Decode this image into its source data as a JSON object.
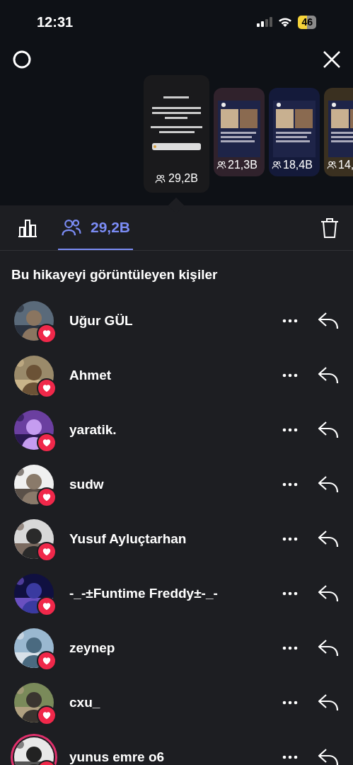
{
  "status_bar": {
    "time": "12:31",
    "battery": "46"
  },
  "stories": [
    {
      "kind": "picture",
      "selected": true,
      "count": "29,2B"
    },
    {
      "kind": "picture",
      "selected": false,
      "count": "21,3B"
    },
    {
      "kind": "picture",
      "selected": false,
      "count": "18,4B"
    },
    {
      "kind": "picture",
      "selected": false,
      "count": "14,"
    }
  ],
  "tabs": [
    {
      "kind": "insights",
      "selected": false
    },
    {
      "kind": "viewers",
      "selected": true,
      "label": "29,2B"
    }
  ],
  "heading": "Bu hikayeyi görüntüleyen kişiler",
  "viewers": [
    {
      "name": "Uğur GÜL",
      "liked": true,
      "story_ring": false
    },
    {
      "name": "Ahmet",
      "liked": true,
      "story_ring": false
    },
    {
      "name": "yaratik.",
      "liked": true,
      "story_ring": false
    },
    {
      "name": "sudw",
      "liked": true,
      "story_ring": false
    },
    {
      "name": "Yusuf Ayluçtarhan",
      "liked": true,
      "story_ring": false
    },
    {
      "name": "-_-±Funtime Freddy±-_-",
      "liked": true,
      "story_ring": false
    },
    {
      "name": "zeynep",
      "liked": true,
      "story_ring": false
    },
    {
      "name": "cxu_",
      "liked": true,
      "story_ring": false
    },
    {
      "name": "yunus emre o6",
      "liked": true,
      "story_ring": true
    }
  ]
}
